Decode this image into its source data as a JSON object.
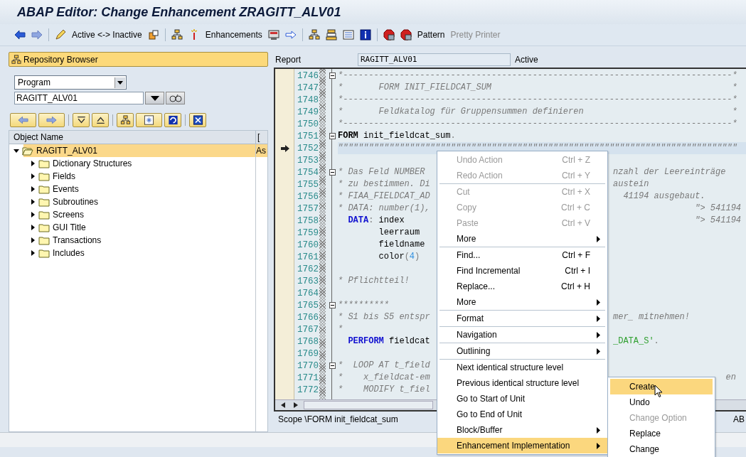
{
  "window": {
    "title": "ABAP Editor: Change Enhancement ZRAGITT_ALV01"
  },
  "toolbar": [
    {
      "kind": "icon"
    },
    {
      "kind": "icon"
    },
    {
      "kind": "sep"
    },
    {
      "kind": "icon"
    },
    {
      "kind": "text",
      "label": "Active <-> Inactive",
      "disabled": false
    },
    {
      "kind": "icon"
    },
    {
      "kind": "sep"
    },
    {
      "kind": "icon"
    },
    {
      "kind": "icon"
    },
    {
      "kind": "text",
      "label": "Enhancements",
      "disabled": false
    },
    {
      "kind": "icon"
    },
    {
      "kind": "icon"
    },
    {
      "kind": "sep"
    },
    {
      "kind": "icon"
    },
    {
      "kind": "icon"
    },
    {
      "kind": "icon"
    },
    {
      "kind": "icon"
    },
    {
      "kind": "sep"
    },
    {
      "kind": "icon"
    },
    {
      "kind": "icon"
    },
    {
      "kind": "text",
      "label": "Pattern",
      "disabled": false
    },
    {
      "kind": "text",
      "label": "Pretty Printer",
      "disabled": true
    }
  ],
  "repository_browser": {
    "title": "Repository Browser",
    "object_type": "Program",
    "object_name": "RAGITT_ALV01",
    "tree": {
      "columns": [
        "Object Name",
        "["
      ],
      "root": {
        "label": "RAGITT_ALV01",
        "column_2": "As",
        "expanded": true,
        "selected": true,
        "children": [
          {
            "label": "Dictionary Structures",
            "expanded": false
          },
          {
            "label": "Fields",
            "expanded": false
          },
          {
            "label": "Events",
            "expanded": false
          },
          {
            "label": "Subroutines",
            "expanded": false
          },
          {
            "label": "Screens",
            "expanded": false
          },
          {
            "label": "GUI Title",
            "expanded": false
          },
          {
            "label": "Transactions",
            "expanded": false
          },
          {
            "label": "Includes",
            "expanded": false
          }
        ]
      }
    }
  },
  "editor": {
    "report_label": "Report",
    "report_value": "RAGITT_ALV01",
    "status": "Active",
    "lines": [
      {
        "no": "1746",
        "fold": true,
        "current": false,
        "code": [
          {
            "kind": "comment",
            "text": "*----------------------------------------------------------------------------*"
          }
        ]
      },
      {
        "no": "1747",
        "fold": false,
        "current": false,
        "code": [
          {
            "kind": "comment",
            "text": "*       FORM INIT_FIELDCAT_SUM                                               *"
          }
        ]
      },
      {
        "no": "1748",
        "fold": false,
        "current": false,
        "code": [
          {
            "kind": "comment",
            "text": "*----------------------------------------------------------------------------*"
          }
        ]
      },
      {
        "no": "1749",
        "fold": false,
        "current": false,
        "code": [
          {
            "kind": "comment",
            "text": "*       Feldkatalog für Gruppensummen definieren                             *"
          }
        ]
      },
      {
        "no": "1750",
        "fold": false,
        "current": false,
        "code": [
          {
            "kind": "comment",
            "text": "*----------------------------------------------------------------------------*"
          }
        ]
      },
      {
        "no": "1751",
        "fold": true,
        "current": false,
        "code": [
          {
            "kind": "bold",
            "text": "FORM"
          },
          {
            "kind": "plain",
            "text": " init_fieldcat_sum"
          },
          {
            "kind": "punct",
            "text": "."
          }
        ]
      },
      {
        "no": "1752",
        "fold": false,
        "current": true,
        "code": [
          {
            "kind": "comment",
            "text": "\"\"\"\"\"\"\"\"\"\"\"\"\"\"\"\"\"\"\"\"\"\"\"\"\"\"\"\"\"\"\"\"\"\"\"\"\"\"\"\"\"\"\"\"\"\"\"\"\"\"\"\"\"\"\"\"\"\"\"\"\"\"\"\"\"\"\"\"\"\"\"\"\"\"\"\"\"\""
          }
        ]
      },
      {
        "no": "1753",
        "fold": false,
        "current": false
      },
      {
        "no": "1754",
        "fold": true,
        "current": false,
        "code": [
          {
            "kind": "comment",
            "text": "* Das Feld NUMBER"
          }
        ],
        "tail": [
          {
            "kind": "comment",
            "text": "nzahl der Leereinträge"
          }
        ]
      },
      {
        "no": "1755",
        "fold": false,
        "current": false,
        "code": [
          {
            "kind": "comment",
            "text": "* zu bestimmen. Di"
          }
        ],
        "tail": [
          {
            "kind": "comment",
            "text": "austein"
          }
        ]
      },
      {
        "no": "1756",
        "fold": false,
        "current": false,
        "code": [
          {
            "kind": "comment",
            "text": "* FIAA_FIELDCAT_AD"
          }
        ],
        "tail": [
          {
            "kind": "comment",
            "text": "  41194 ausgebaut."
          }
        ]
      },
      {
        "no": "1757",
        "fold": false,
        "current": false,
        "code": [
          {
            "kind": "comment",
            "text": "* DATA: number(1),"
          }
        ],
        "tail": [
          {
            "kind": "comment",
            "text": "                \"> 541194"
          }
        ]
      },
      {
        "no": "1758",
        "fold": false,
        "current": false,
        "code": [
          {
            "kind": "keyword",
            "text": "  DATA"
          },
          {
            "kind": "punct",
            "text": ":"
          },
          {
            "kind": "plain",
            "text": " index"
          }
        ],
        "tail": [
          {
            "kind": "comment",
            "text": "                \"> 541194"
          }
        ]
      },
      {
        "no": "1759",
        "fold": false,
        "current": false,
        "code": [
          {
            "kind": "plain",
            "text": "        leerraum"
          }
        ]
      },
      {
        "no": "1760",
        "fold": false,
        "current": false,
        "code": [
          {
            "kind": "plain",
            "text": "        fieldname"
          }
        ]
      },
      {
        "no": "1761",
        "fold": false,
        "current": false,
        "code": [
          {
            "kind": "plain",
            "text": "        color"
          },
          {
            "kind": "punct",
            "text": "("
          },
          {
            "kind": "number",
            "text": "4"
          },
          {
            "kind": "punct",
            "text": ")"
          }
        ]
      },
      {
        "no": "1762",
        "fold": false,
        "current": false
      },
      {
        "no": "1763",
        "fold": false,
        "current": false,
        "code": [
          {
            "kind": "comment",
            "text": "* Pflichtteil!"
          }
        ]
      },
      {
        "no": "1764",
        "fold": false,
        "current": false
      },
      {
        "no": "1765",
        "fold": true,
        "current": false,
        "code": [
          {
            "kind": "comment",
            "text": "**********"
          }
        ]
      },
      {
        "no": "1766",
        "fold": false,
        "current": false,
        "code": [
          {
            "kind": "comment",
            "text": "* S1 bis S5 entspr"
          }
        ],
        "tail": [
          {
            "kind": "comment",
            "text": "mer_ mitnehmen!"
          }
        ]
      },
      {
        "no": "1767",
        "fold": false,
        "current": false,
        "code": [
          {
            "kind": "comment",
            "text": "*"
          }
        ]
      },
      {
        "no": "1768",
        "fold": false,
        "current": false,
        "code": [
          {
            "kind": "keyword",
            "text": "  PERFORM"
          },
          {
            "kind": "plain",
            "text": " fieldcat"
          }
        ],
        "tail": [
          {
            "kind": "string",
            "text": "_DATA_S'"
          },
          {
            "kind": "punct",
            "text": "."
          }
        ]
      },
      {
        "no": "1769",
        "fold": false,
        "current": false
      },
      {
        "no": "1770",
        "fold": true,
        "current": false,
        "code": [
          {
            "kind": "comment",
            "text": "*  LOOP AT t_field"
          }
        ]
      },
      {
        "no": "1771",
        "fold": false,
        "current": false,
        "code": [
          {
            "kind": "comment",
            "text": "*    x_fieldcat-em"
          }
        ],
        "tail": [
          {
            "kind": "comment",
            "text": "                      en"
          }
        ]
      },
      {
        "no": "1772",
        "fold": false,
        "current": false,
        "code": [
          {
            "kind": "comment",
            "text": "*    MODIFY t_fiel"
          }
        ]
      }
    ],
    "scope": "Scope \\FORM init_fieldcat_sum",
    "status_right": "AB"
  },
  "context_menu": {
    "items": [
      {
        "kind": "item",
        "label": "Undo Action",
        "shortcut": "Ctrl + Z",
        "disabled": true,
        "submenu": false,
        "selected": false
      },
      {
        "kind": "item",
        "label": "Redo Action",
        "shortcut": "Ctrl + Y",
        "disabled": true,
        "submenu": false,
        "selected": false
      },
      {
        "kind": "separator"
      },
      {
        "kind": "item",
        "label": "Cut",
        "shortcut": "Ctrl + X",
        "disabled": true,
        "submenu": false,
        "selected": false
      },
      {
        "kind": "item",
        "label": "Copy",
        "shortcut": "Ctrl + C",
        "disabled": true,
        "submenu": false,
        "selected": false
      },
      {
        "kind": "item",
        "label": "Paste",
        "shortcut": "Ctrl + V",
        "disabled": true,
        "submenu": false,
        "selected": false
      },
      {
        "kind": "item",
        "label": "More",
        "disabled": false,
        "submenu": true,
        "selected": false
      },
      {
        "kind": "separator"
      },
      {
        "kind": "item",
        "label": "Find...",
        "shortcut": "Ctrl + F",
        "disabled": false,
        "submenu": false,
        "selected": false
      },
      {
        "kind": "item",
        "label": "Find Incremental",
        "shortcut": "Ctrl + I",
        "disabled": false,
        "submenu": false,
        "selected": false
      },
      {
        "kind": "item",
        "label": "Replace...",
        "shortcut": "Ctrl + H",
        "disabled": false,
        "submenu": false,
        "selected": false
      },
      {
        "kind": "item",
        "label": "More",
        "disabled": false,
        "submenu": true,
        "selected": false
      },
      {
        "kind": "separator"
      },
      {
        "kind": "item",
        "label": "Format",
        "disabled": false,
        "submenu": true,
        "selected": false
      },
      {
        "kind": "separator"
      },
      {
        "kind": "item",
        "label": "Navigation",
        "disabled": false,
        "submenu": true,
        "selected": false
      },
      {
        "kind": "separator"
      },
      {
        "kind": "item",
        "label": "Outlining",
        "disabled": false,
        "submenu": true,
        "selected": false
      },
      {
        "kind": "separator"
      },
      {
        "kind": "item",
        "label": "Next identical structure level",
        "disabled": false,
        "submenu": false,
        "selected": false
      },
      {
        "kind": "item",
        "label": "Previous identical structure level",
        "disabled": false,
        "submenu": false,
        "selected": false
      },
      {
        "kind": "item",
        "label": "Go to Start of Unit",
        "disabled": false,
        "submenu": false,
        "selected": false
      },
      {
        "kind": "item",
        "label": "Go to End of Unit",
        "disabled": false,
        "submenu": false,
        "selected": false
      },
      {
        "kind": "item",
        "label": "Block/Buffer",
        "disabled": false,
        "submenu": true,
        "selected": false
      },
      {
        "kind": "item",
        "label": "Enhancement Implementation",
        "disabled": false,
        "submenu": true,
        "selected": true
      }
    ]
  },
  "submenu": {
    "items": [
      {
        "label": "Create",
        "disabled": false,
        "selected": true
      },
      {
        "label": "Undo",
        "disabled": false,
        "selected": false
      },
      {
        "label": "Change Option",
        "disabled": true,
        "selected": false
      },
      {
        "label": "Replace",
        "disabled": false,
        "selected": false
      },
      {
        "label": "Change",
        "disabled": false,
        "selected": false
      }
    ]
  }
}
